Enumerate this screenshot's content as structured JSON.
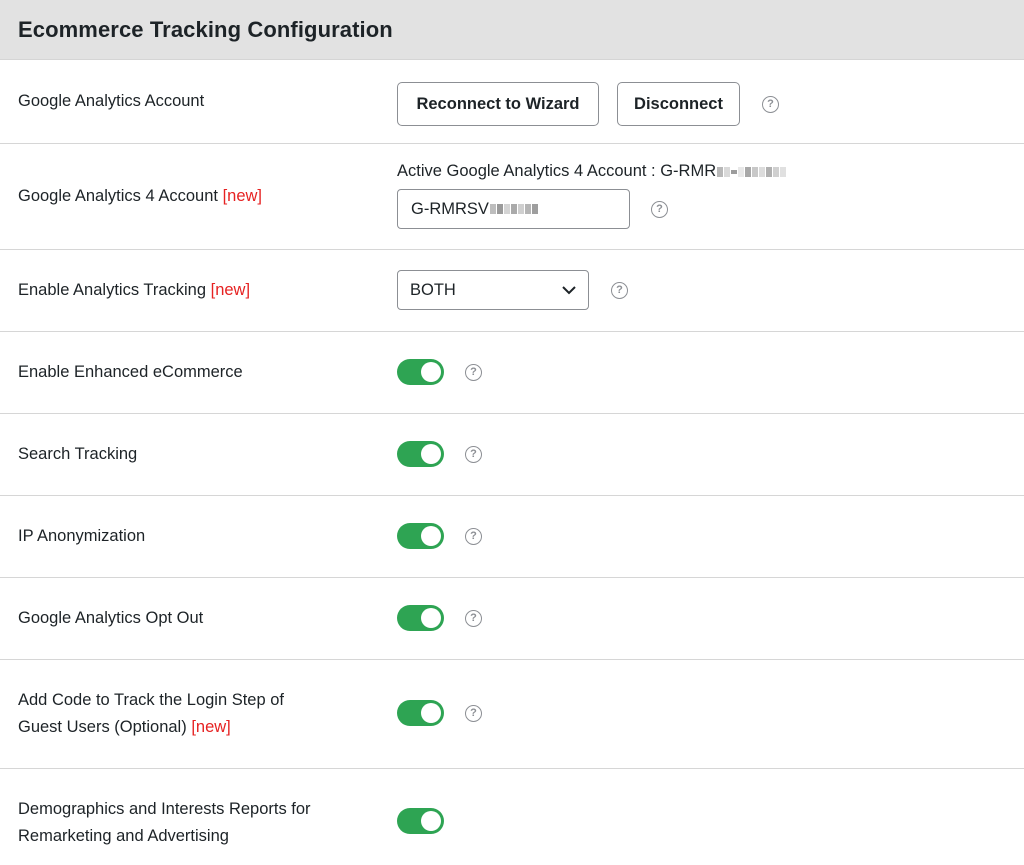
{
  "header": {
    "title": "Ecommerce Tracking Configuration"
  },
  "new_tag": "[new]",
  "rows": {
    "ga_account": {
      "label": "Google Analytics Account",
      "reconnect_label": "Reconnect to Wizard",
      "disconnect_label": "Disconnect"
    },
    "ga4_account": {
      "label": "Google Analytics 4 Account",
      "active_text": "Active Google Analytics 4 Account : G-RMR",
      "input_value": "G-RMRSV"
    },
    "analytics_tracking": {
      "label": "Enable Analytics Tracking",
      "selected": "BOTH"
    },
    "enhanced_ecommerce": {
      "label": "Enable Enhanced eCommerce",
      "enabled": true
    },
    "search_tracking": {
      "label": "Search Tracking",
      "enabled": true
    },
    "ip_anonymization": {
      "label": "IP Anonymization",
      "enabled": true
    },
    "ga_opt_out": {
      "label": "Google Analytics Opt Out",
      "enabled": true
    },
    "guest_login": {
      "label_line1": "Add Code to Track the Login Step of",
      "label_line2": "Guest Users (Optional)",
      "enabled": true
    },
    "demographics": {
      "label_line1": "Demographics and Interests Reports for",
      "label_line2": "Remarketing and Advertising",
      "enabled": true
    }
  },
  "colors": {
    "toggle_on": "#2ea453",
    "new_tag": "#e62222",
    "header_bg": "#e2e2e2"
  }
}
